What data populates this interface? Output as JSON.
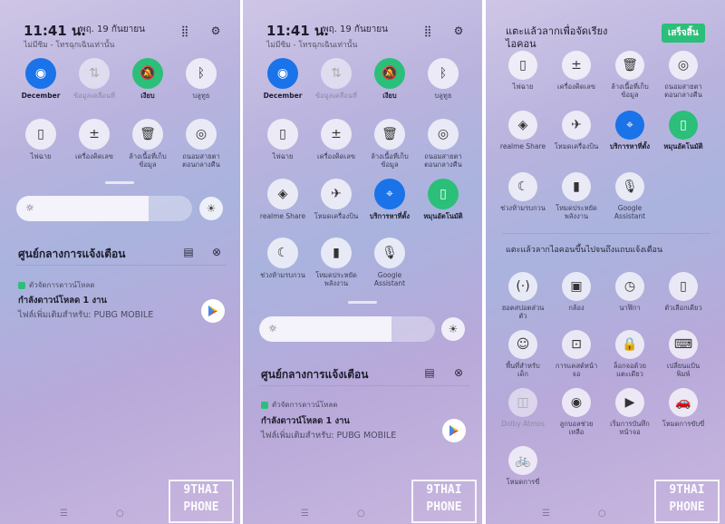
{
  "status": {
    "time": "11:41 น.",
    "date": "พฤ. 19 กันยายน",
    "carrier": "ไม่มีซิม - โทรฉุกเฉินเท่านั้น"
  },
  "tiles": {
    "wifi": "December",
    "data": "ข้อมูลเคลื่อนที่",
    "silent": "เงียบ",
    "bluetooth": "บลูทูธ",
    "flashlight": "ไฟฉาย",
    "calculator": "เครื่องคิดเลข",
    "clean1": "ล้างเนื้อที่เก็บ",
    "clean2": "ข้อมูล",
    "eye1": "ถนอมสายตา",
    "eye2": "ตอนกลางคืน",
    "share": "realme Share",
    "airplane": "โหมดเครื่องบิน",
    "location": "บริการหาที่ตั้ง",
    "rotate": "หมุนอัตโนมัติ",
    "dnd": "ช่วงห้ามรบกวน",
    "saver1": "โหมดประหยัด",
    "saver2": "พลังงาน",
    "assistant1": "Google",
    "assistant2": "Assistant"
  },
  "notif": {
    "center": "ศูนย์กลางการแจ้งเตือน",
    "app": "ตัวจัดการดาวน์โหลด",
    "title": "กำลังดาวน์โหลด 1 งาน",
    "text": "ไฟล์เพิ่มเติมสำหรับ: PUBG MOBILE"
  },
  "edit": {
    "title1": "แตะแล้วลากเพื่อจัดเรียง",
    "title2": "ไอคอน",
    "done": "เสร็จสิ้น",
    "section": "แตะแล้วลากไอคอนขึ้นไปจนถึงแถบแจ้งเตือน",
    "extra": [
      {
        "l1": "ฮอตสปอตส่วน",
        "l2": "ตัว",
        "icon": "(·)"
      },
      {
        "l1": "กล้อง",
        "l2": "",
        "icon": "▣"
      },
      {
        "l1": "นาฬิกา",
        "l2": "",
        "icon": "◷"
      },
      {
        "l1": "ตัวเลือกเดียว",
        "l2": "",
        "icon": "▯"
      },
      {
        "l1": "พื้นที่สำหรับ",
        "l2": "เด็ก",
        "icon": "☺"
      },
      {
        "l1": "การแคสต์หน้า",
        "l2": "จอ",
        "icon": "⊡"
      },
      {
        "l1": "ล็อกจอด้วย",
        "l2": "แตะเดียว",
        "icon": "🔒"
      },
      {
        "l1": "เปลี่ยนแป้น",
        "l2": "พิมพ์",
        "icon": "⌨"
      },
      {
        "l1": "Dolby Atmos",
        "l2": "",
        "icon": "◫"
      },
      {
        "l1": "ลูกบอลช่วย",
        "l2": "เหลือ",
        "icon": "◉"
      },
      {
        "l1": "เริ่มการบันทึก",
        "l2": "หน้าจอ",
        "icon": "▶"
      },
      {
        "l1": "โหมดการขับขี่",
        "l2": "",
        "icon": "🚗"
      },
      {
        "l1": "โหมดการขี่",
        "l2": "",
        "icon": "🚲"
      }
    ]
  },
  "watermark": {
    "l1": "9THAI",
    "l2": "PHONE"
  },
  "nav": {
    "menu": "☰",
    "home": "○",
    "back": "◁"
  }
}
